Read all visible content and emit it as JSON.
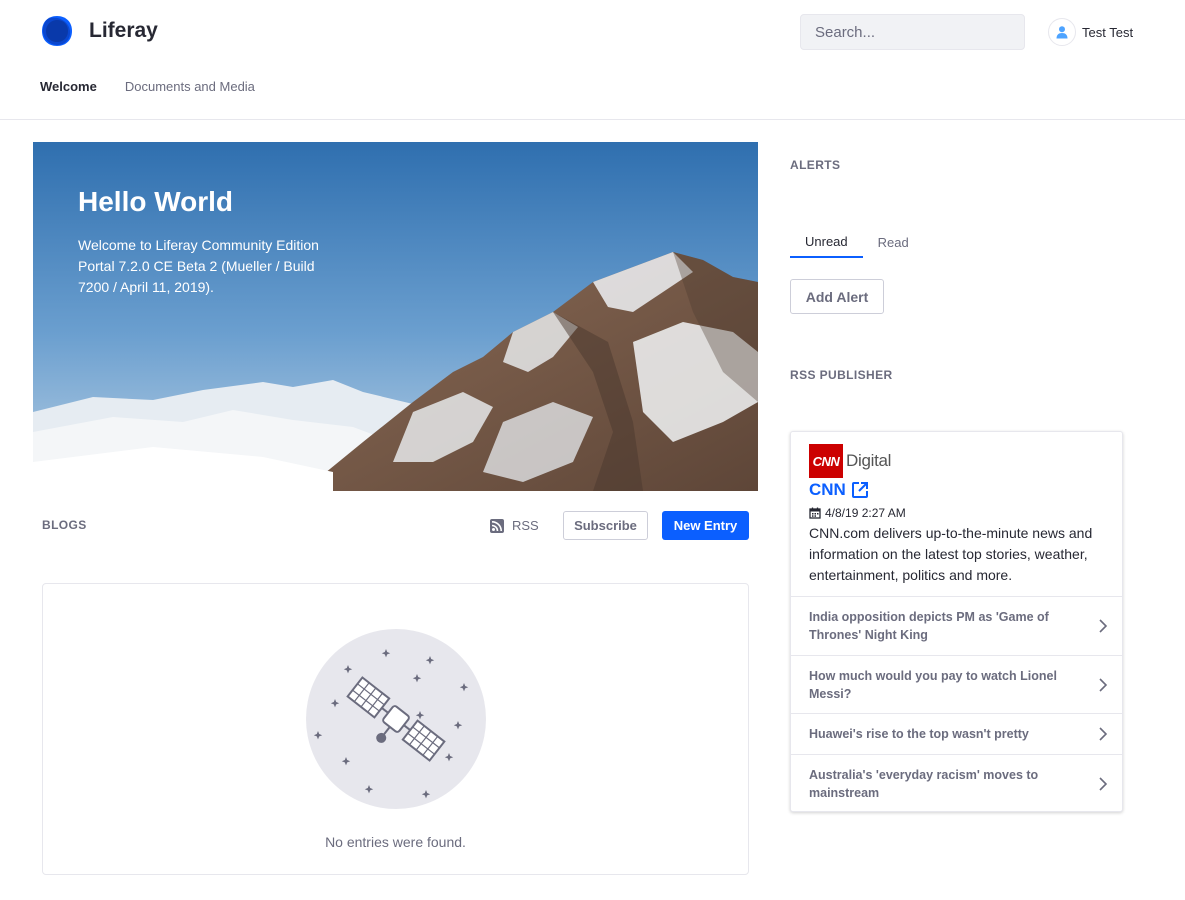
{
  "header": {
    "brand": "Liferay",
    "search_placeholder": "Search...",
    "user_name": "Test Test",
    "nav": [
      {
        "label": "Welcome",
        "active": true
      },
      {
        "label": "Documents and Media",
        "active": false
      }
    ]
  },
  "hero": {
    "title": "Hello World",
    "text": "Welcome to Liferay Community Edition Portal 7.2.0 CE Beta 2 (Mueller / Build 7200 / April 11, 2019)."
  },
  "blogs": {
    "label": "BLOGS",
    "rss_label": "RSS",
    "subscribe_label": "Subscribe",
    "new_entry_label": "New Entry",
    "empty_text": "No entries were found."
  },
  "alerts": {
    "label": "ALERTS",
    "tabs": [
      {
        "label": "Unread",
        "active": true
      },
      {
        "label": "Read",
        "active": false
      }
    ],
    "add_label": "Add Alert"
  },
  "rss_publisher": {
    "label": "RSS PUBLISHER",
    "feed": {
      "logo_text": "CNN",
      "logo_suffix": "Digital",
      "title": "CNN",
      "date": "4/8/19 2:27 AM",
      "description": "CNN.com delivers up-to-the-minute news and information on the latest top stories, weather, entertainment, politics and more."
    },
    "items": [
      {
        "title": "India opposition depicts PM as 'Game of Thrones' Night King"
      },
      {
        "title": "How much would you pay to watch Lionel Messi?"
      },
      {
        "title": "Huawei's rise to the top wasn't pretty"
      },
      {
        "title": "Australia's 'everyday racism' moves to mainstream"
      }
    ]
  },
  "colors": {
    "primary": "#0b5fff",
    "text": "#272833",
    "secondary_text": "#6b6c7e",
    "border": "#e7e7ed",
    "cnn_red": "#cc0000"
  }
}
